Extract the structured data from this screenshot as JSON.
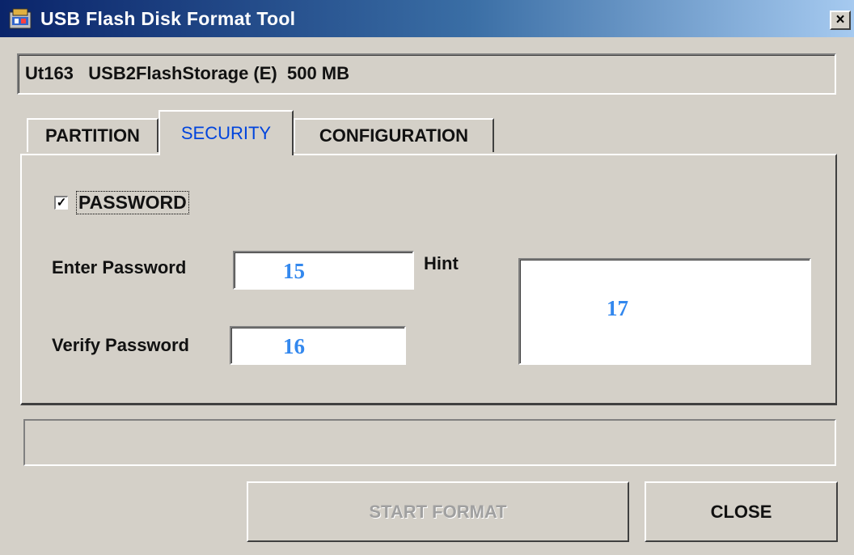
{
  "window": {
    "title": "USB Flash Disk Format Tool",
    "close_glyph": "×"
  },
  "device": {
    "info": "Ut163   USB2FlashStorage (E)  500 MB"
  },
  "tabs": [
    {
      "label": "PARTITION",
      "active": false
    },
    {
      "label": "SECURITY",
      "active": true
    },
    {
      "label": "CONFIGURATION",
      "active": false
    }
  ],
  "security": {
    "password_checkbox": {
      "label": "PASSWORD",
      "checked": true,
      "check_glyph": "✓"
    },
    "enter_password": {
      "label": "Enter Password",
      "marker": "15"
    },
    "verify_password": {
      "label": "Verify Password",
      "marker": "16"
    },
    "hint": {
      "label": "Hint",
      "marker": "17"
    }
  },
  "status": {
    "text": ""
  },
  "buttons": {
    "start_format": {
      "label": "START FORMAT",
      "enabled": false
    },
    "close": {
      "label": "CLOSE",
      "enabled": true
    }
  },
  "colors": {
    "active_tab_text": "#0044dd",
    "marker_text": "#3388ee",
    "titlebar_start": "#0a246a",
    "titlebar_end": "#a6caf0"
  },
  "icons": {
    "app": "usb-disk-app-icon",
    "close": "close-icon",
    "checkbox": "checkmark-icon"
  }
}
